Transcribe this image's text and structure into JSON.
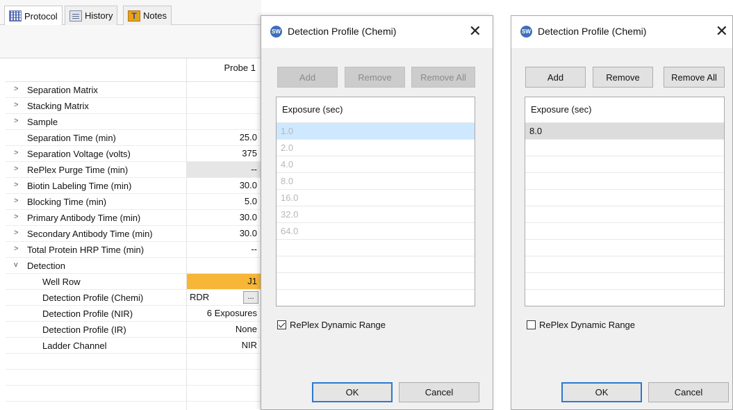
{
  "tabs": [
    {
      "label": "Protocol",
      "icon": "grid-icon"
    },
    {
      "label": "History",
      "icon": "history-icon"
    },
    {
      "label": "Notes",
      "icon": "notes-icon"
    }
  ],
  "grid": {
    "column_header": "Probe 1",
    "rows": [
      {
        "label": "Separation Matrix",
        "value": "",
        "expander": ">"
      },
      {
        "label": "Stacking Matrix",
        "value": "",
        "expander": ">"
      },
      {
        "label": "Sample",
        "value": "",
        "expander": ">"
      },
      {
        "label": "Separation Time (min)",
        "value": "25.0",
        "expander": ""
      },
      {
        "label": "Separation Voltage (volts)",
        "value": "375",
        "expander": ">"
      },
      {
        "label": "RePlex Purge Time (min)",
        "value": "--",
        "expander": ">"
      },
      {
        "label": "Biotin Labeling Time (min)",
        "value": "30.0",
        "expander": ">"
      },
      {
        "label": "Blocking Time (min)",
        "value": "5.0",
        "expander": ">"
      },
      {
        "label": "Primary Antibody Time (min)",
        "value": "30.0",
        "expander": ">"
      },
      {
        "label": "Secondary Antibody Time (min)",
        "value": "30.0",
        "expander": ">"
      },
      {
        "label": "Total Protein HRP Time (min)",
        "value": "--",
        "expander": ">"
      },
      {
        "label": "Detection",
        "value": "",
        "expander": "v"
      },
      {
        "label": "Well Row",
        "value": "J1",
        "expander": ""
      },
      {
        "label": "Detection Profile (Chemi)",
        "value": "RDR",
        "expander": "",
        "button": "..."
      },
      {
        "label": "Detection Profile (NIR)",
        "value": "6 Exposures",
        "expander": ""
      },
      {
        "label": "Detection Profile (IR)",
        "value": "None",
        "expander": ""
      },
      {
        "label": "Ladder Channel",
        "value": "NIR",
        "expander": ""
      }
    ]
  },
  "dialog1": {
    "title": "Detection Profile (Chemi)",
    "logo": "SW",
    "close": "✕",
    "buttons": {
      "add": "Add",
      "remove": "Remove",
      "remove_all": "Remove All"
    },
    "list_header": "Exposure (sec)",
    "items": [
      "1.0",
      "2.0",
      "4.0",
      "8.0",
      "16.0",
      "32.0",
      "64.0"
    ],
    "checkbox_label": "RePlex Dynamic Range",
    "checkbox_checked": true,
    "ok": "OK",
    "cancel": "Cancel"
  },
  "dialog2": {
    "title": "Detection Profile (Chemi)",
    "logo": "SW",
    "close": "✕",
    "buttons": {
      "add": "Add",
      "remove": "Remove",
      "remove_all": "Remove All"
    },
    "list_header": "Exposure (sec)",
    "items": [
      "8.0"
    ],
    "checkbox_label": "RePlex Dynamic Range",
    "checkbox_checked": false,
    "ok": "OK",
    "cancel": "Cancel"
  },
  "colors": {
    "highlight_orange": "#f7b638",
    "selection_blue": "#cde8ff",
    "focus_blue": "#2b78d0"
  }
}
